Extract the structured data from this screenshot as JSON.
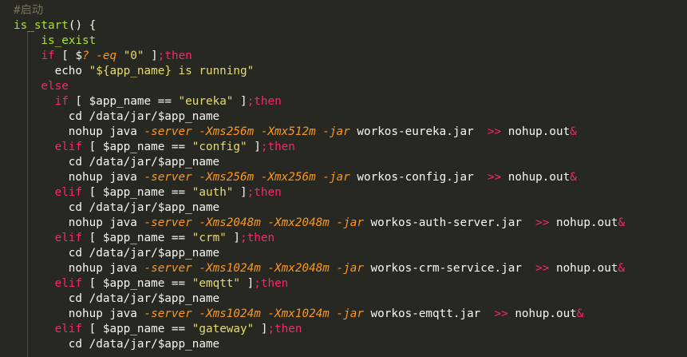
{
  "colors": {
    "background": "#272822",
    "comment": "#75715e",
    "function": "#a6e22e",
    "keyword": "#f92672",
    "string": "#e6db74",
    "plain": "#f8f8f2",
    "flag": "#fd971f",
    "guide": "#4a4a44"
  },
  "lines": [
    {
      "indent": 0,
      "tokens": [
        {
          "c": "comment",
          "t": "#启动"
        }
      ]
    },
    {
      "indent": 0,
      "tokens": [
        {
          "c": "func",
          "t": "is_start"
        },
        {
          "c": "plain",
          "t": "() {"
        }
      ]
    },
    {
      "indent": 4,
      "tokens": [
        {
          "c": "func",
          "t": "is_exist"
        }
      ]
    },
    {
      "indent": 4,
      "tokens": [
        {
          "c": "kw",
          "t": "if"
        },
        {
          "c": "plain",
          "t": " [ "
        },
        {
          "c": "plain",
          "t": "$"
        },
        {
          "c": "ital",
          "t": "?"
        },
        {
          "c": "plain",
          "t": " "
        },
        {
          "c": "ital",
          "t": "-eq"
        },
        {
          "c": "plain",
          "t": " "
        },
        {
          "c": "str",
          "t": "\"0\""
        },
        {
          "c": "plain",
          "t": " ]"
        },
        {
          "c": "kw",
          "t": ";then"
        }
      ]
    },
    {
      "indent": 6,
      "tokens": [
        {
          "c": "plain",
          "t": "echo "
        },
        {
          "c": "str",
          "t": "\"${app_name} is running\""
        }
      ]
    },
    {
      "indent": 4,
      "tokens": [
        {
          "c": "kw",
          "t": "else"
        }
      ]
    },
    {
      "indent": 6,
      "tokens": [
        {
          "c": "kw",
          "t": "if"
        },
        {
          "c": "plain",
          "t": " [ $app_name == "
        },
        {
          "c": "str",
          "t": "\"eureka\""
        },
        {
          "c": "plain",
          "t": " ]"
        },
        {
          "c": "kw",
          "t": ";then"
        }
      ]
    },
    {
      "indent": 8,
      "tokens": [
        {
          "c": "plain",
          "t": "cd /data/jar/$app_name"
        }
      ]
    },
    {
      "indent": 8,
      "tokens": [
        {
          "c": "plain",
          "t": "nohup java "
        },
        {
          "c": "ital",
          "t": "-server"
        },
        {
          "c": "plain",
          "t": " "
        },
        {
          "c": "ital",
          "t": "-Xms256m"
        },
        {
          "c": "plain",
          "t": " "
        },
        {
          "c": "ital",
          "t": "-Xmx512m"
        },
        {
          "c": "plain",
          "t": " "
        },
        {
          "c": "ital",
          "t": "-jar"
        },
        {
          "c": "plain",
          "t": " workos-eureka.jar  "
        },
        {
          "c": "kw",
          "t": ">>"
        },
        {
          "c": "plain",
          "t": " nohup.out"
        },
        {
          "c": "kw",
          "t": "&"
        }
      ]
    },
    {
      "indent": 6,
      "tokens": [
        {
          "c": "kw",
          "t": "elif"
        },
        {
          "c": "plain",
          "t": " [ $app_name == "
        },
        {
          "c": "str",
          "t": "\"config\""
        },
        {
          "c": "plain",
          "t": " ]"
        },
        {
          "c": "kw",
          "t": ";then"
        }
      ]
    },
    {
      "indent": 8,
      "tokens": [
        {
          "c": "plain",
          "t": "cd /data/jar/$app_name"
        }
      ]
    },
    {
      "indent": 8,
      "tokens": [
        {
          "c": "plain",
          "t": "nohup java "
        },
        {
          "c": "ital",
          "t": "-server"
        },
        {
          "c": "plain",
          "t": " "
        },
        {
          "c": "ital",
          "t": "-Xms256m"
        },
        {
          "c": "plain",
          "t": " "
        },
        {
          "c": "ital",
          "t": "-Xmx256m"
        },
        {
          "c": "plain",
          "t": " "
        },
        {
          "c": "ital",
          "t": "-jar"
        },
        {
          "c": "plain",
          "t": " workos-config.jar  "
        },
        {
          "c": "kw",
          "t": ">>"
        },
        {
          "c": "plain",
          "t": " nohup.out"
        },
        {
          "c": "kw",
          "t": "&"
        }
      ]
    },
    {
      "indent": 6,
      "tokens": [
        {
          "c": "kw",
          "t": "elif"
        },
        {
          "c": "plain",
          "t": " [ $app_name == "
        },
        {
          "c": "str",
          "t": "\"auth\""
        },
        {
          "c": "plain",
          "t": " ]"
        },
        {
          "c": "kw",
          "t": ";then"
        }
      ]
    },
    {
      "indent": 8,
      "tokens": [
        {
          "c": "plain",
          "t": "cd /data/jar/$app_name"
        }
      ]
    },
    {
      "indent": 8,
      "tokens": [
        {
          "c": "plain",
          "t": "nohup java "
        },
        {
          "c": "ital",
          "t": "-server"
        },
        {
          "c": "plain",
          "t": " "
        },
        {
          "c": "ital",
          "t": "-Xms2048m"
        },
        {
          "c": "plain",
          "t": " "
        },
        {
          "c": "ital",
          "t": "-Xmx2048m"
        },
        {
          "c": "plain",
          "t": " "
        },
        {
          "c": "ital",
          "t": "-jar"
        },
        {
          "c": "plain",
          "t": " workos-auth-server.jar  "
        },
        {
          "c": "kw",
          "t": ">>"
        },
        {
          "c": "plain",
          "t": " nohup.out"
        },
        {
          "c": "kw",
          "t": "&"
        }
      ]
    },
    {
      "indent": 6,
      "tokens": [
        {
          "c": "kw",
          "t": "elif"
        },
        {
          "c": "plain",
          "t": " [ $app_name == "
        },
        {
          "c": "str",
          "t": "\"crm\""
        },
        {
          "c": "plain",
          "t": " ]"
        },
        {
          "c": "kw",
          "t": ";then"
        }
      ]
    },
    {
      "indent": 8,
      "tokens": [
        {
          "c": "plain",
          "t": "cd /data/jar/$app_name"
        }
      ]
    },
    {
      "indent": 8,
      "tokens": [
        {
          "c": "plain",
          "t": "nohup java "
        },
        {
          "c": "ital",
          "t": "-server"
        },
        {
          "c": "plain",
          "t": " "
        },
        {
          "c": "ital",
          "t": "-Xms1024m"
        },
        {
          "c": "plain",
          "t": " "
        },
        {
          "c": "ital",
          "t": "-Xmx2048m"
        },
        {
          "c": "plain",
          "t": " "
        },
        {
          "c": "ital",
          "t": "-jar"
        },
        {
          "c": "plain",
          "t": " workos-crm-service.jar  "
        },
        {
          "c": "kw",
          "t": ">>"
        },
        {
          "c": "plain",
          "t": " nohup.out"
        },
        {
          "c": "kw",
          "t": "&"
        }
      ]
    },
    {
      "indent": 6,
      "tokens": [
        {
          "c": "kw",
          "t": "elif"
        },
        {
          "c": "plain",
          "t": " [ $app_name == "
        },
        {
          "c": "str",
          "t": "\"emqtt\""
        },
        {
          "c": "plain",
          "t": " ]"
        },
        {
          "c": "kw",
          "t": ";then"
        }
      ]
    },
    {
      "indent": 8,
      "tokens": [
        {
          "c": "plain",
          "t": "cd /data/jar/$app_name"
        }
      ]
    },
    {
      "indent": 8,
      "tokens": [
        {
          "c": "plain",
          "t": "nohup java "
        },
        {
          "c": "ital",
          "t": "-server"
        },
        {
          "c": "plain",
          "t": " "
        },
        {
          "c": "ital",
          "t": "-Xms1024m"
        },
        {
          "c": "plain",
          "t": " "
        },
        {
          "c": "ital",
          "t": "-Xmx1024m"
        },
        {
          "c": "plain",
          "t": " "
        },
        {
          "c": "ital",
          "t": "-jar"
        },
        {
          "c": "plain",
          "t": " workos-emqtt.jar  "
        },
        {
          "c": "kw",
          "t": ">>"
        },
        {
          "c": "plain",
          "t": " nohup.out"
        },
        {
          "c": "kw",
          "t": "&"
        }
      ]
    },
    {
      "indent": 6,
      "tokens": [
        {
          "c": "kw",
          "t": "elif"
        },
        {
          "c": "plain",
          "t": " [ $app_name == "
        },
        {
          "c": "str",
          "t": "\"gateway\""
        },
        {
          "c": "plain",
          "t": " ]"
        },
        {
          "c": "kw",
          "t": ";then"
        }
      ]
    },
    {
      "indent": 8,
      "tokens": [
        {
          "c": "plain",
          "t": "cd /data/jar/$app_name"
        }
      ]
    }
  ]
}
